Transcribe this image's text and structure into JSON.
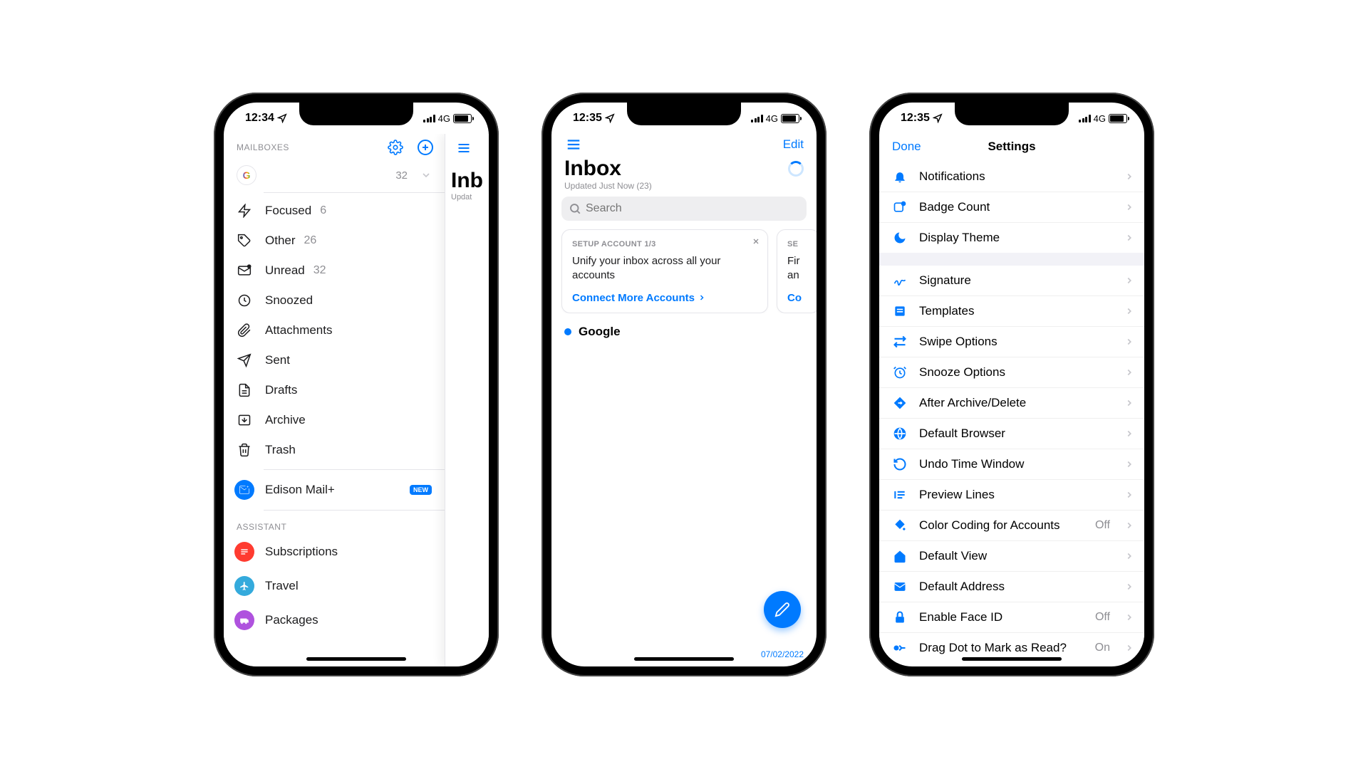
{
  "status": {
    "time1": "12:34",
    "time2": "12:35",
    "time3": "12:35",
    "network": "4G"
  },
  "screen1": {
    "mailboxes_label": "MAILBOXES",
    "account_letter": "G",
    "account_count": "32",
    "items": [
      {
        "label": "Focused",
        "count": "6"
      },
      {
        "label": "Other",
        "count": "26"
      },
      {
        "label": "Unread",
        "count": "32"
      },
      {
        "label": "Snoozed",
        "count": ""
      },
      {
        "label": "Attachments",
        "count": ""
      },
      {
        "label": "Sent",
        "count": ""
      },
      {
        "label": "Drafts",
        "count": ""
      },
      {
        "label": "Archive",
        "count": ""
      },
      {
        "label": "Trash",
        "count": ""
      }
    ],
    "premium_label": "Edison Mail+",
    "premium_badge": "NEW",
    "assistant_label": "ASSISTANT",
    "assistant": [
      {
        "label": "Subscriptions",
        "color": "#ff3b30"
      },
      {
        "label": "Travel",
        "color": "#34aadc"
      },
      {
        "label": "Packages",
        "color": "#af52de"
      }
    ],
    "peek_title": "Inb",
    "peek_sub": "Updat"
  },
  "screen2": {
    "edit": "Edit",
    "title": "Inbox",
    "subtitle": "Updated Just Now (23)",
    "search_placeholder": "Search",
    "card": {
      "step": "SETUP ACCOUNT 1/3",
      "text": "Unify your inbox across all your accounts",
      "cta": "Connect More Accounts"
    },
    "card2": {
      "step": "SE",
      "text": "Fir\nan",
      "cta": "Co"
    },
    "thread": "Google",
    "date": "07/02/2022"
  },
  "screen3": {
    "done": "Done",
    "title": "Settings",
    "group1": [
      {
        "label": "Notifications"
      },
      {
        "label": "Badge Count"
      },
      {
        "label": "Display Theme"
      }
    ],
    "group2": [
      {
        "label": "Signature"
      },
      {
        "label": "Templates"
      },
      {
        "label": "Swipe Options"
      },
      {
        "label": "Snooze Options"
      },
      {
        "label": "After Archive/Delete"
      },
      {
        "label": "Default Browser"
      },
      {
        "label": "Undo Time Window"
      },
      {
        "label": "Preview Lines"
      },
      {
        "label": "Color Coding for Accounts",
        "value": "Off"
      },
      {
        "label": "Default View"
      },
      {
        "label": "Default Address"
      },
      {
        "label": "Enable Face ID",
        "value": "Off"
      },
      {
        "label": "Drag Dot to Mark as Read?",
        "value": "On"
      }
    ]
  }
}
